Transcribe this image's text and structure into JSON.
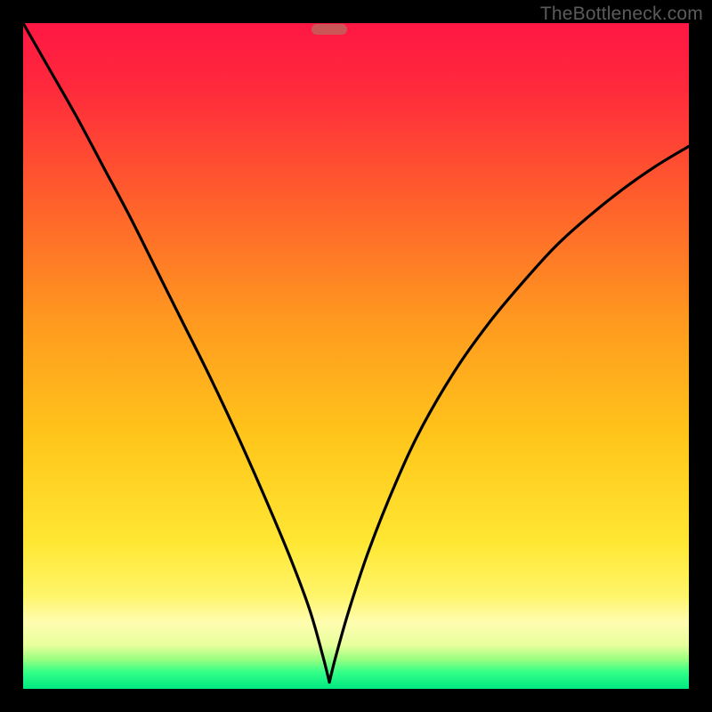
{
  "watermark": {
    "text": "TheBottleneck.com"
  },
  "chart_data": {
    "type": "line",
    "title": "",
    "xlabel": "",
    "ylabel": "",
    "xlim": [
      0,
      100
    ],
    "ylim": [
      0,
      100
    ],
    "grid": false,
    "legend": false,
    "gradient_stops": [
      {
        "offset": 0,
        "color": "#ff1744"
      },
      {
        "offset": 0.1,
        "color": "#ff2a3c"
      },
      {
        "offset": 0.25,
        "color": "#ff5a2d"
      },
      {
        "offset": 0.45,
        "color": "#ff9a1f"
      },
      {
        "offset": 0.62,
        "color": "#ffc51a"
      },
      {
        "offset": 0.78,
        "color": "#ffe733"
      },
      {
        "offset": 0.86,
        "color": "#fff56a"
      },
      {
        "offset": 0.9,
        "color": "#fffdb0"
      },
      {
        "offset": 0.935,
        "color": "#e6ff9c"
      },
      {
        "offset": 0.955,
        "color": "#9cff80"
      },
      {
        "offset": 0.975,
        "color": "#33ff88"
      },
      {
        "offset": 1.0,
        "color": "#00e880"
      }
    ],
    "minimum_marker": {
      "x": 46,
      "y": 99,
      "color": "#cb5658"
    },
    "series": [
      {
        "name": "left-curve",
        "x": [
          0,
          4,
          8,
          12,
          16,
          20,
          24,
          28,
          32,
          36,
          40,
          43,
          45,
          46
        ],
        "y": [
          100,
          93,
          86,
          78.5,
          71,
          63,
          55,
          47,
          38.5,
          29.5,
          20,
          12,
          5,
          1
        ]
      },
      {
        "name": "right-curve",
        "x": [
          46,
          47,
          49,
          52,
          56,
          60,
          65,
          70,
          75,
          80,
          85,
          90,
          95,
          100
        ],
        "y": [
          1,
          5,
          12,
          21,
          31,
          39.5,
          48,
          55,
          61,
          66.5,
          71,
          75,
          78.5,
          81.5
        ]
      }
    ]
  }
}
